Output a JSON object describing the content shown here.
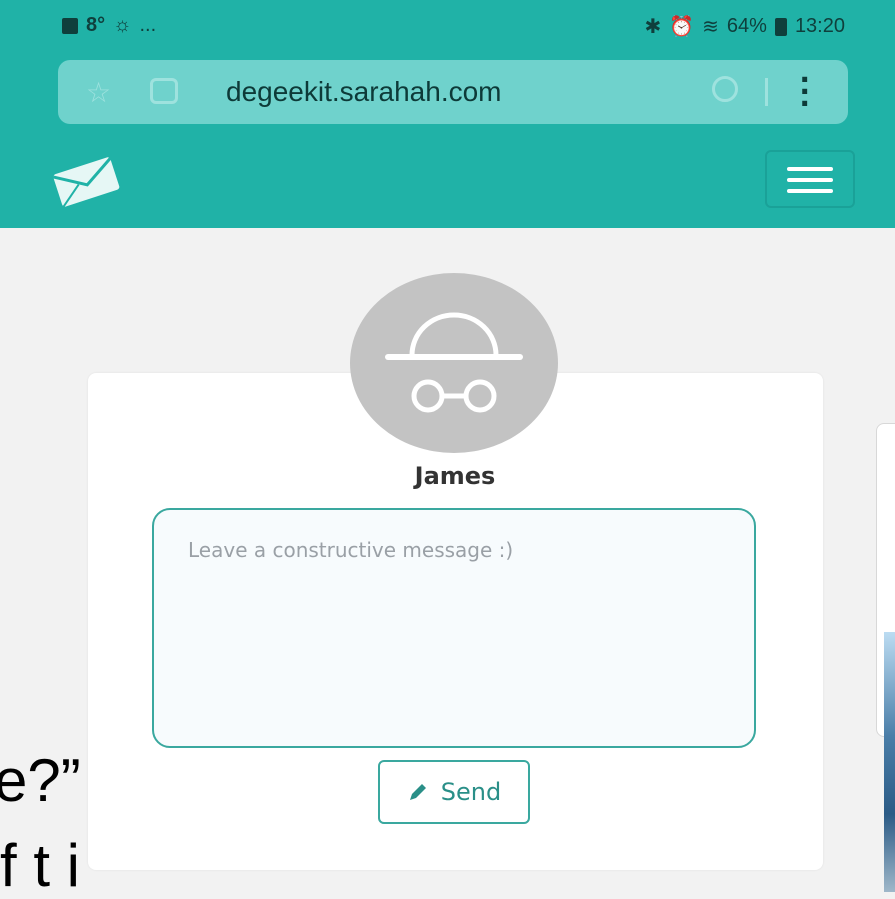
{
  "status_bar": {
    "left_temp": "8°",
    "left_more": "...",
    "battery": "64%",
    "time": "13:20"
  },
  "browser": {
    "url": "degeekit.sarahah.com"
  },
  "profile": {
    "name": "James"
  },
  "message_box": {
    "placeholder": "Leave a constructive message :)"
  },
  "send_button": {
    "label": "Send"
  },
  "overlay_text": {
    "line1": "e?”",
    "line2": "f t   i"
  },
  "colors": {
    "brand_teal": "#20b2a7",
    "accent_border": "#3aa89f",
    "avatar_gray": "#c3c3c3"
  },
  "icons": [
    "envelope-logo-icon",
    "hamburger-menu-icon",
    "anonymous-avatar-icon",
    "pencil-icon",
    "star-icon",
    "share-icon",
    "reload-icon",
    "overflow-menu-icon"
  ]
}
